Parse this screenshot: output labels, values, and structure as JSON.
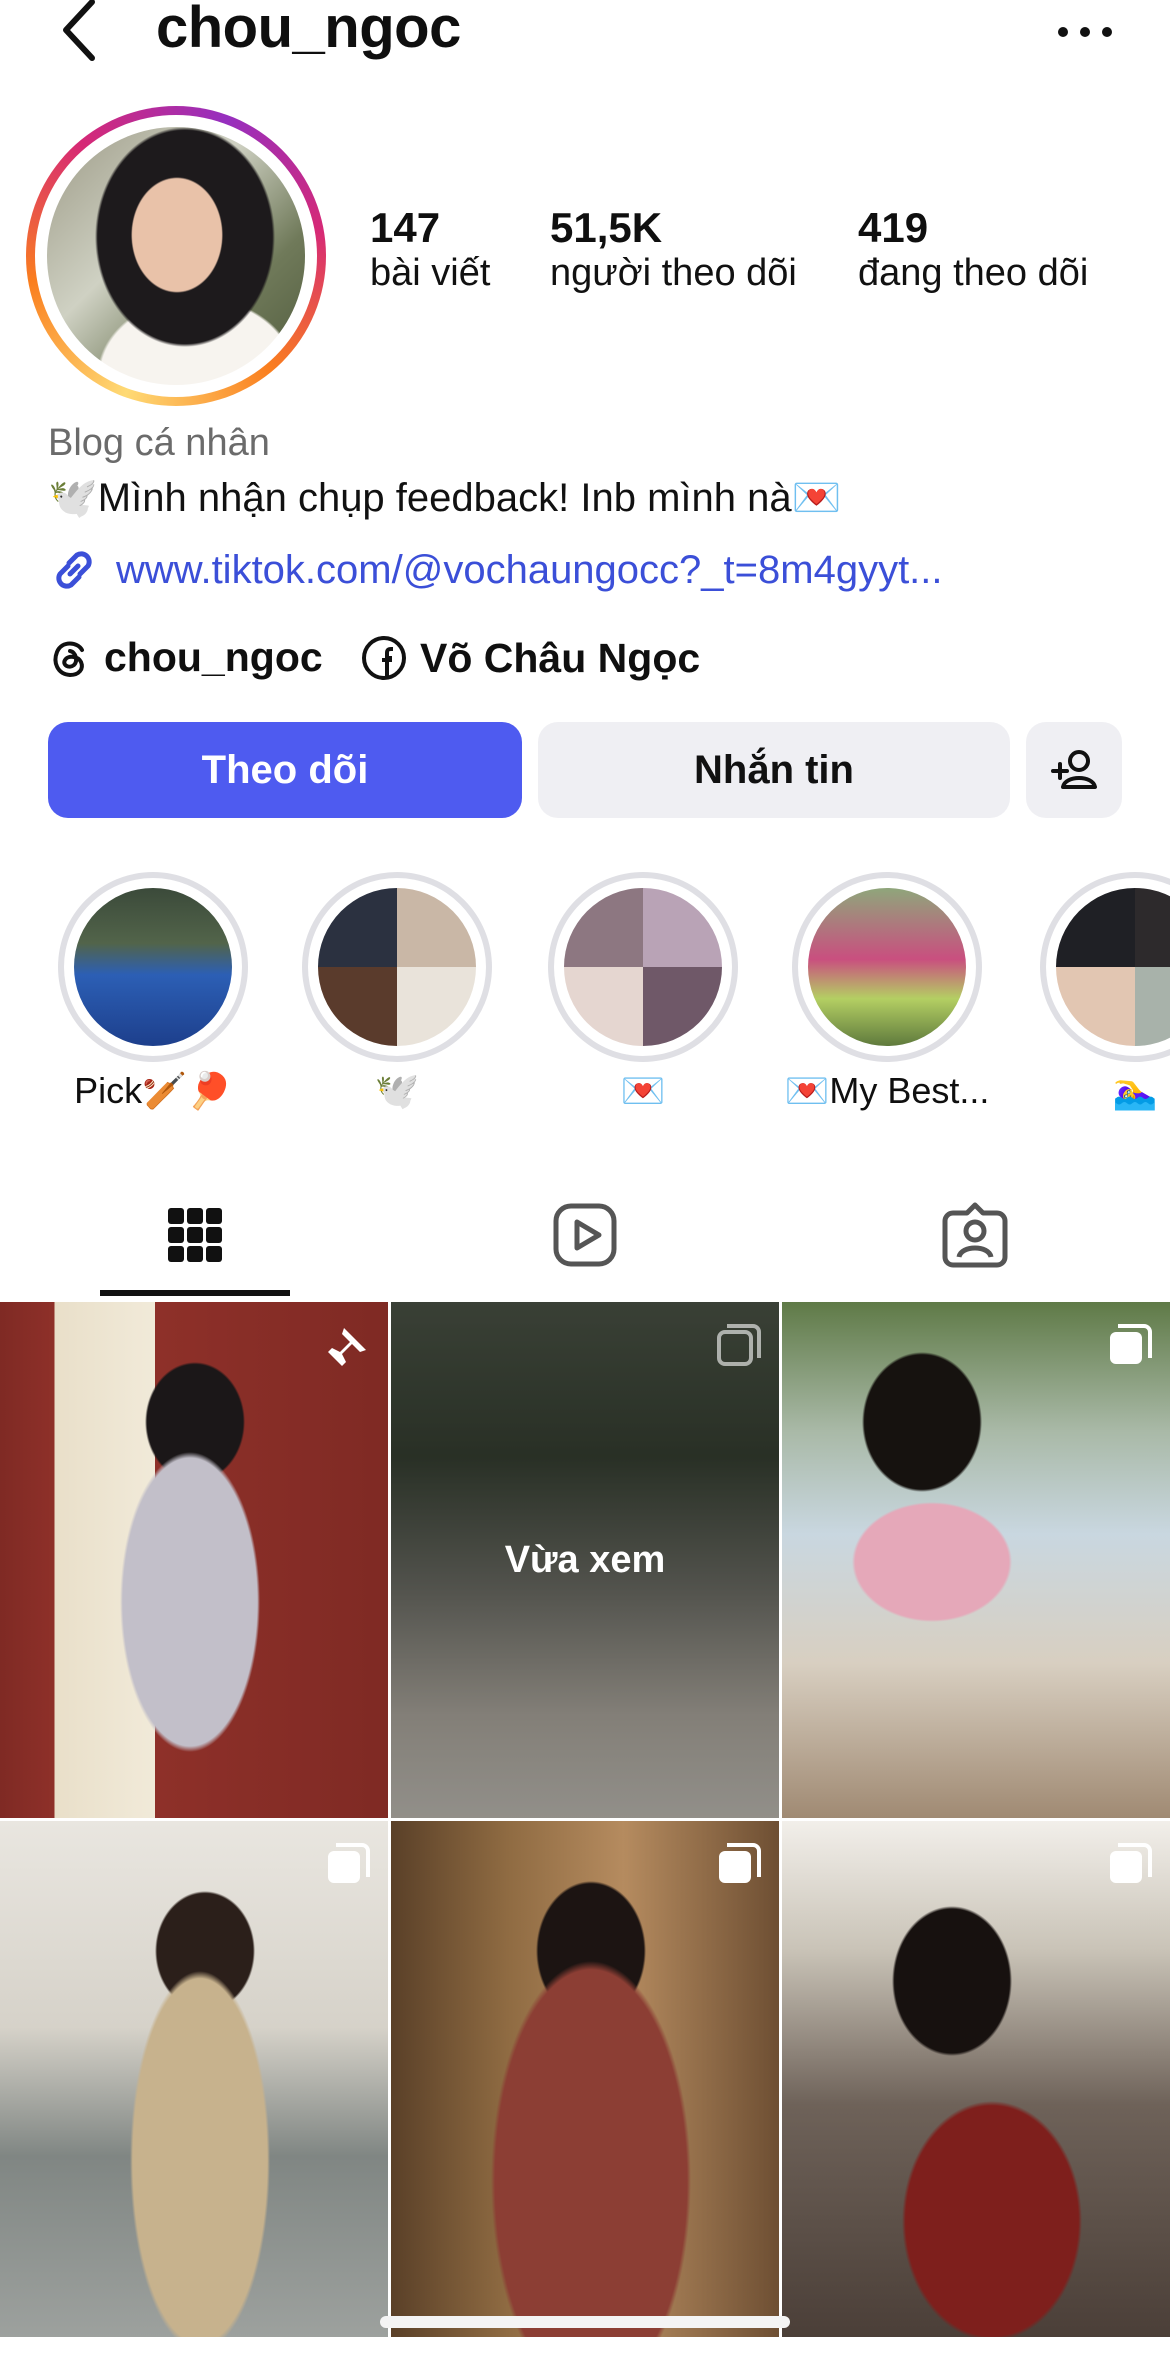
{
  "header": {
    "username": "chou_ngoc"
  },
  "stats": [
    {
      "value": "147",
      "label": "bài viết"
    },
    {
      "value": "51,5K",
      "label": "người theo dõi"
    },
    {
      "value": "419",
      "label": "đang theo dõi"
    }
  ],
  "bio": {
    "category": "Blog cá nhân",
    "text": "🕊️Mình nhận chụp feedback! Inb mình nà💌",
    "link": "www.tiktok.com/@vochaungocc?_t=8m4gyyt...",
    "threads_handle": "chou_ngoc",
    "facebook_name": "Võ Châu Ngọc"
  },
  "actions": {
    "follow": "Theo dõi",
    "message": "Nhắn tin"
  },
  "highlights": [
    {
      "label": "Pick🏏🏓"
    },
    {
      "label": "🕊️"
    },
    {
      "label": "💌"
    },
    {
      "label": "💌My Best..."
    },
    {
      "label": "🏊‍♀️"
    }
  ],
  "grid": {
    "recent_label": "Vừa xem"
  },
  "colors": {
    "accent": "#4e5bf0",
    "link": "#3b4fd8"
  }
}
